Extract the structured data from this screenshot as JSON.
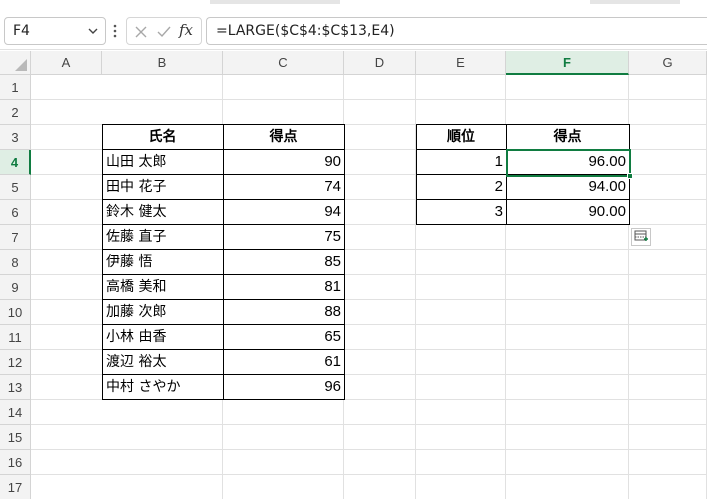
{
  "formula_bar": {
    "name_box": "F4",
    "formula": "=LARGE($C$4:$C$13,E4)",
    "fx_label": "fx"
  },
  "columns": [
    "A",
    "B",
    "C",
    "D",
    "E",
    "F",
    "G"
  ],
  "rows": [
    "1",
    "2",
    "3",
    "4",
    "5",
    "6",
    "7",
    "8",
    "9",
    "10",
    "11",
    "12",
    "13",
    "14",
    "15",
    "16",
    "17"
  ],
  "table1": {
    "headers": [
      "氏名",
      "得点"
    ],
    "rows": [
      {
        "name": "山田 太郎",
        "score": "90"
      },
      {
        "name": "田中 花子",
        "score": "74"
      },
      {
        "name": "鈴木 健太",
        "score": "94"
      },
      {
        "name": "佐藤 直子",
        "score": "75"
      },
      {
        "name": "伊藤 悟",
        "score": "85"
      },
      {
        "name": "高橋 美和",
        "score": "81"
      },
      {
        "name": "加藤 次郎",
        "score": "88"
      },
      {
        "name": "小林 由香",
        "score": "65"
      },
      {
        "name": "渡辺 裕太",
        "score": "61"
      },
      {
        "name": "中村 さやか",
        "score": "96"
      }
    ]
  },
  "table2": {
    "headers": [
      "順位",
      "得点"
    ],
    "rows": [
      {
        "rank": "1",
        "score": "96.00"
      },
      {
        "rank": "2",
        "score": "94.00"
      },
      {
        "rank": "3",
        "score": "90.00"
      }
    ]
  },
  "selection": {
    "column": "F",
    "row": "4"
  },
  "colors": {
    "accent": "#107c41",
    "header_bg": "#f3f3f3",
    "gridline": "#e1e1e1"
  },
  "icons": {
    "cancel": "close-icon",
    "enter": "check-icon",
    "insert_function": "fx-icon",
    "quick_analysis": "quick-analysis-icon"
  }
}
